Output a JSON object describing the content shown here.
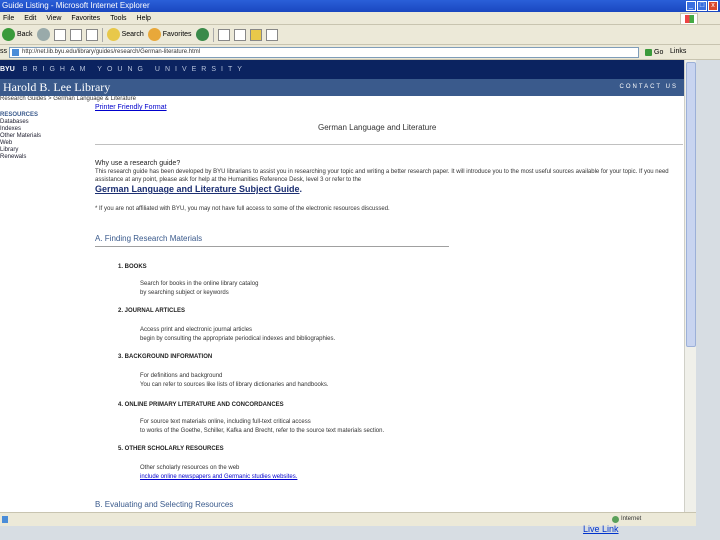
{
  "window": {
    "title": "Guide Listing - Microsoft Internet Explorer",
    "buttons": [
      "_",
      "□",
      "x"
    ]
  },
  "menu": [
    "File",
    "Edit",
    "View",
    "Favorites",
    "Tools",
    "Help"
  ],
  "toolbar": {
    "back": "Back",
    "search": "Search",
    "favorites": "Favorites"
  },
  "address": {
    "label": "ss",
    "url": "http://net.lib.byu.edu/library/guides/research/German-literature.html",
    "go": "Go",
    "links": "Links"
  },
  "banner": {
    "short": "BYU",
    "university": "BRIGHAM YOUNG UNIVERSITY"
  },
  "library": {
    "name": "Harold B. Lee Library",
    "catalog": "CONTACT US"
  },
  "page": {
    "breadcrumb": "Research Guides > German Language & Literature",
    "printer_link": "Printer Friendly Format",
    "sidebar_head": "RESOURCES",
    "sidebar_items": [
      "Databases",
      "Indexes",
      "Other Materials",
      "Web",
      "Library",
      "Renewals"
    ],
    "heading": "German Language and Literature",
    "why_title": "Why use a research guide?",
    "why_body": "This research guide has been developed by BYU librarians to assist you in researching your topic and writing a better research paper. It will introduce you to the most useful sources available for your topic. If you need assistance at any point, please ask for help at the Humanities Reference Desk, level 3 or refer to the",
    "subject_guide_prefix": "German Language and Literature Subject Guide",
    "subject_guide_suffix": ".",
    "note": "* If you are not affiliated with BYU, you may not have full access to some of the electronic resources discussed.",
    "section_a": "A. Finding Research Materials",
    "items": [
      {
        "title": "1. BOOKS",
        "lines": [
          "Search for books in the online library catalog",
          "by searching subject or keywords"
        ]
      },
      {
        "title": "2. JOURNAL ARTICLES",
        "lines": [
          "Access print and electronic journal articles",
          "begin by consulting the appropriate periodical indexes and bibliographies."
        ]
      },
      {
        "title": "3. BACKGROUND INFORMATION",
        "lines": [
          "For definitions and background",
          "You can refer to sources like lists of library dictionaries and handbooks."
        ]
      },
      {
        "title": "4. ONLINE PRIMARY LITERATURE AND CONCORDANCES",
        "lines": [
          "For source text materials online, including full-text critical access",
          "to works of the Goethe, Schiller, Kafka and Brecht, refer to the source text materials section."
        ]
      },
      {
        "title": "5. OTHER SCHOLARLY RESOURCES",
        "lines": [
          "Other scholarly resources on the web",
          "include online newspapers and Germanic studies websites."
        ]
      }
    ],
    "section_b": "B. Evaluating and Selecting Resources"
  },
  "status": {
    "zone": "Internet"
  },
  "overlay": {
    "live_link": "Live Link"
  }
}
